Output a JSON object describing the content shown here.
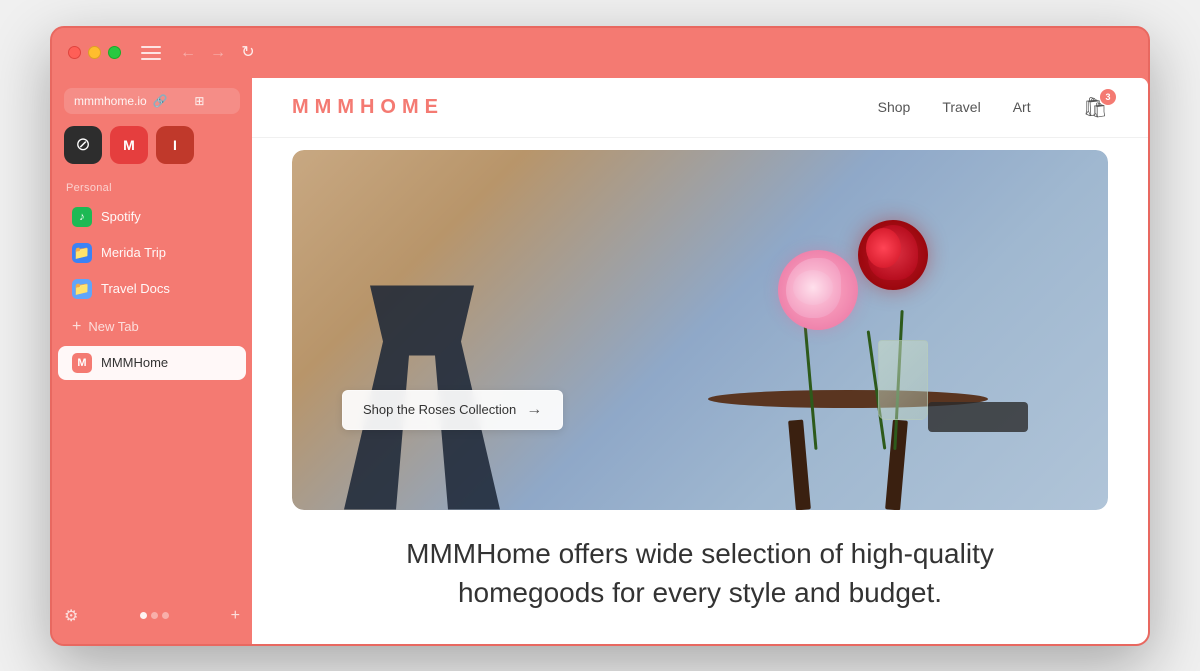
{
  "browser": {
    "url": "mmmhome.io",
    "title": "MMMHome"
  },
  "traffic_lights": {
    "red_label": "close",
    "yellow_label": "minimize",
    "green_label": "maximize"
  },
  "nav_controls": {
    "back": "←",
    "forward": "→",
    "refresh": "↻"
  },
  "sidebar_toggle_label": "sidebar",
  "app_icons": [
    {
      "id": "blocked-icon",
      "symbol": "⊘",
      "bg": "dark"
    },
    {
      "id": "gmail-icon",
      "symbol": "M",
      "bg": "red-bg"
    },
    {
      "id": "instapaper-icon",
      "symbol": "I",
      "bg": "red2-bg"
    }
  ],
  "sidebar": {
    "section_label": "Personal",
    "new_tab_label": "New Tab",
    "items": [
      {
        "id": "spotify",
        "label": "Spotify",
        "icon": "♪",
        "icon_bg": "spotify"
      },
      {
        "id": "merida-trip",
        "label": "Merida Trip",
        "icon": "📁",
        "icon_bg": "blue"
      },
      {
        "id": "travel-docs",
        "label": "Travel Docs",
        "icon": "📁",
        "icon_bg": "blue2"
      }
    ],
    "active_tab": {
      "id": "mmmhome",
      "label": "MMMHome",
      "icon": "M",
      "icon_bg": "active-m"
    }
  },
  "bottom_controls": {
    "settings_icon": "⚙",
    "add_tab_icon": "+"
  },
  "website": {
    "logo": "MMMHOME",
    "nav_links": [
      {
        "id": "shop",
        "label": "Shop"
      },
      {
        "id": "travel",
        "label": "Travel"
      },
      {
        "id": "art",
        "label": "Art"
      }
    ],
    "cart_badge": "3",
    "hero_cta": "Shop the Roses Collection",
    "hero_cta_arrow": "→",
    "description_line1": "MMMHome offers wide selection of high-quality",
    "description_line2": "homegoods for every style and budget."
  }
}
